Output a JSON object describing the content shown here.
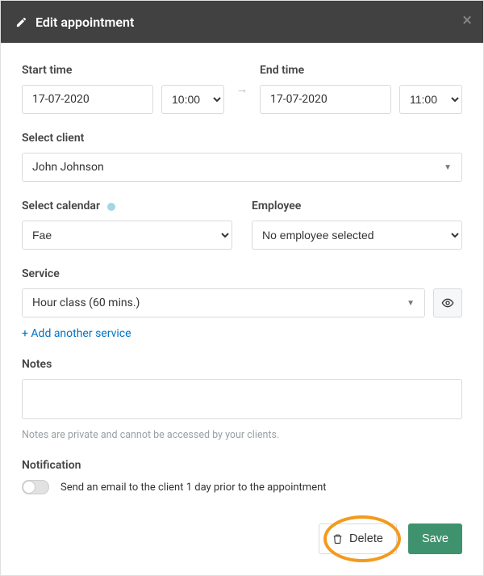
{
  "header": {
    "title": "Edit appointment"
  },
  "start": {
    "label": "Start time",
    "date": "17-07-2020",
    "time": "10:00"
  },
  "end": {
    "label": "End time",
    "date": "17-07-2020",
    "time": "11:00"
  },
  "client": {
    "label": "Select client",
    "value": "John Johnson"
  },
  "calendar": {
    "label": "Select calendar",
    "value": "Fae"
  },
  "employee": {
    "label": "Employee",
    "value": "No employee selected"
  },
  "service": {
    "label": "Service",
    "value": "Hour class (60 mins.)",
    "add_link": "+ Add another service"
  },
  "notes": {
    "label": "Notes",
    "help": "Notes are private and cannot be accessed by your clients."
  },
  "notification": {
    "label": "Notification",
    "text": "Send an email to the client 1 day prior to the appointment"
  },
  "buttons": {
    "delete": "Delete",
    "save": "Save"
  }
}
